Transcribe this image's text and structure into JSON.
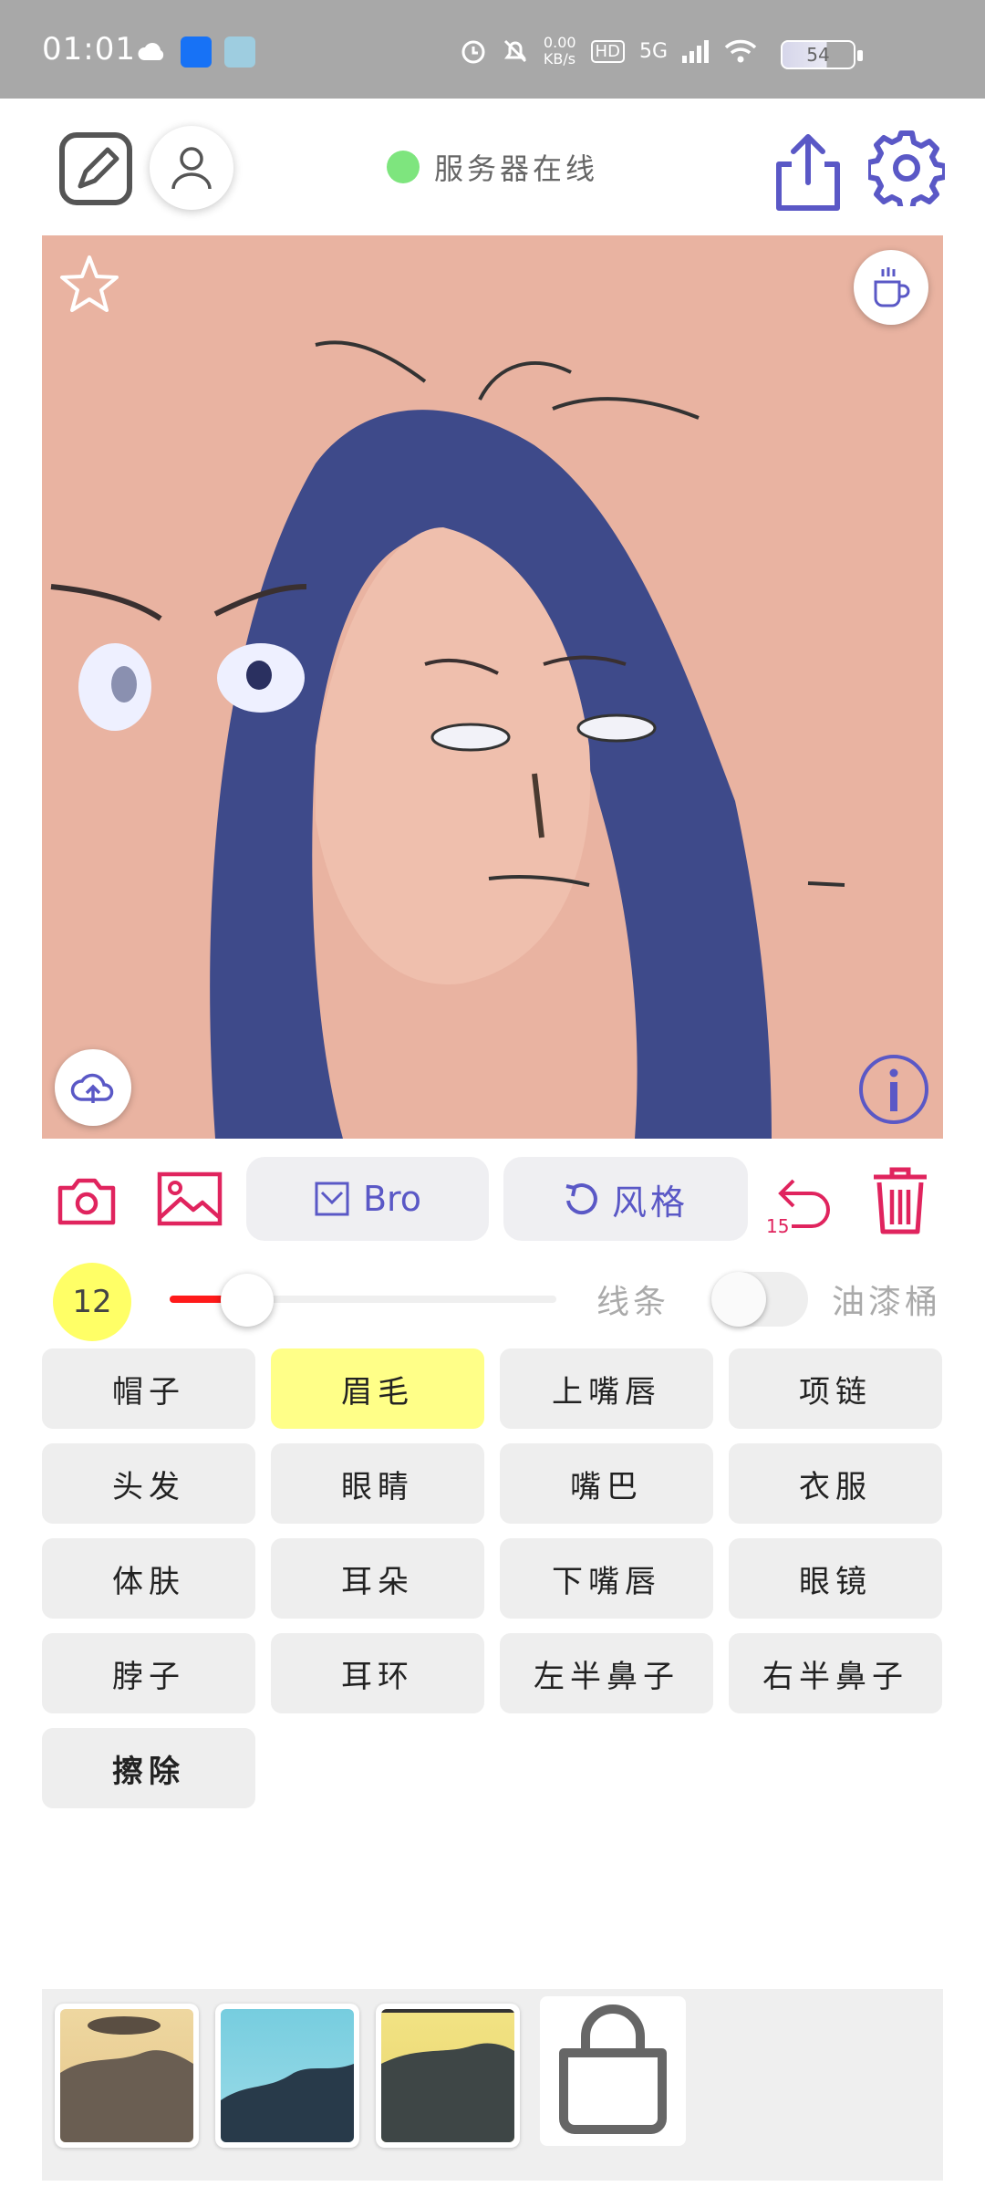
{
  "status_bar": {
    "time": "01:01",
    "net_speed_top": "0.00",
    "net_speed_unit": "KB/s",
    "network": "5G",
    "hd": "HD",
    "battery": "54"
  },
  "header": {
    "server_status": "服务器在线",
    "server_color": "#7ee57e"
  },
  "toolbar": {
    "model_label": "Bro",
    "style_label": "风格",
    "undo_count": "15"
  },
  "slider": {
    "brush_size": "12",
    "brush_fraction": 0.2,
    "line_label": "线条",
    "bucket_label": "油漆桶",
    "bucket_enabled": false
  },
  "parts": [
    {
      "label": "帽子"
    },
    {
      "label": "眉毛",
      "active": true
    },
    {
      "label": "上嘴唇"
    },
    {
      "label": "项链"
    },
    {
      "label": "头发"
    },
    {
      "label": "眼睛"
    },
    {
      "label": "嘴巴"
    },
    {
      "label": "衣服"
    },
    {
      "label": "体肤"
    },
    {
      "label": "耳朵"
    },
    {
      "label": "下嘴唇"
    },
    {
      "label": "眼镜"
    },
    {
      "label": "脖子"
    },
    {
      "label": "耳环"
    },
    {
      "label": "左半鼻子"
    },
    {
      "label": "右半鼻子"
    },
    {
      "label": "擦除",
      "bold": true
    }
  ],
  "colors": {
    "accent_red": "#e0245e",
    "accent_purple": "#5a58c6",
    "canvas_bg": "#e8b09e",
    "hair": "#3f4a86",
    "active_chip": "#ffff88"
  }
}
